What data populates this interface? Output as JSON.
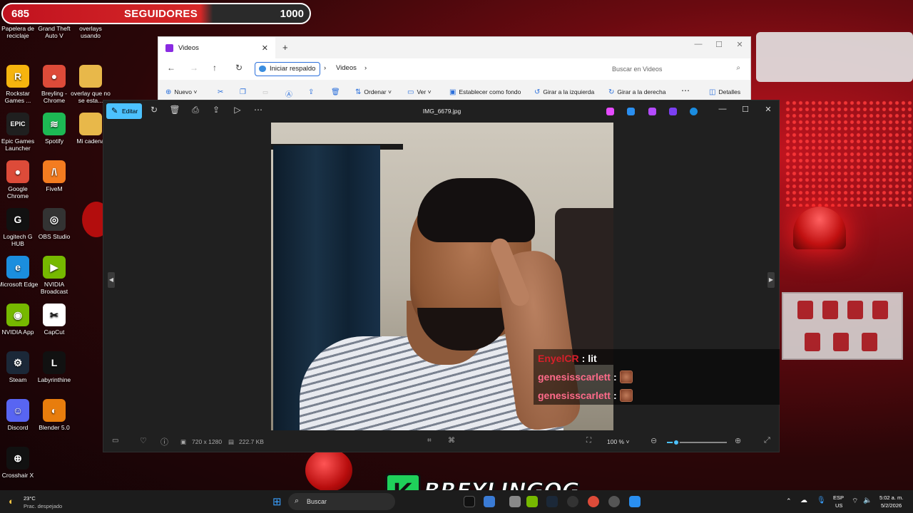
{
  "followers": {
    "current": "685",
    "label": "SEGUIDORES",
    "goal": "1000",
    "progress_fraction": 0.685
  },
  "desktop_icons": [
    {
      "label": "Papelera de reciclaje",
      "color": "#9aa7b3",
      "glyph": "🗑"
    },
    {
      "label": "Grand Theft Auto V",
      "color": "#6b4a2b",
      "glyph": "V"
    },
    {
      "label": "overlays usando",
      "color": "#e8b84a",
      "glyph": ""
    },
    {
      "label": "Rockstar Games ...",
      "color": "#f6b40e",
      "glyph": "R"
    },
    {
      "label": "Breyling - Chrome",
      "color": "#dd4b39",
      "glyph": "●"
    },
    {
      "label": "overlay que no se esta...",
      "color": "#e8b84a",
      "glyph": ""
    },
    {
      "label": "Epic Games Launcher",
      "color": "#1f1f1f",
      "glyph": "EPIC"
    },
    {
      "label": "Spotify",
      "color": "#1db954",
      "glyph": "≋"
    },
    {
      "label": "Mi cadena",
      "color": "#e8b84a",
      "glyph": ""
    },
    {
      "label": "Google Chrome",
      "color": "#dd4b39",
      "glyph": "●"
    },
    {
      "label": "FiveM",
      "color": "#f47c20",
      "glyph": "/\\"
    },
    {
      "label": "Logitech G HUB",
      "color": "#111111",
      "glyph": "G"
    },
    {
      "label": "OBS Studio",
      "color": "#333333",
      "glyph": "◎"
    },
    {
      "label": "Microsoft Edge",
      "color": "#1b8ede",
      "glyph": "e"
    },
    {
      "label": "NVIDIA Broadcast",
      "color": "#76b900",
      "glyph": "▶"
    },
    {
      "label": "NVIDIA App",
      "color": "#76b900",
      "glyph": "◉"
    },
    {
      "label": "CapCut",
      "color": "#ffffff",
      "glyph": "✂"
    },
    {
      "label": "Steam",
      "color": "#1b2838",
      "glyph": "⚙"
    },
    {
      "label": "Labyrinthine",
      "color": "#111111",
      "glyph": "L"
    },
    {
      "label": "Discord",
      "color": "#5865f2",
      "glyph": "☺"
    },
    {
      "label": "Blender 5.0",
      "color": "#e87d0d",
      "glyph": "◐"
    },
    {
      "label": "Crosshair X",
      "color": "#111111",
      "glyph": "⊕"
    }
  ],
  "explorer": {
    "tab_title": "Videos",
    "backup_button": "Iniciar respaldo",
    "breadcrumb": "Videos",
    "search_placeholder": "Buscar en Videos",
    "commands": {
      "new": "Nuevo",
      "sort": "Ordenar",
      "view": "Ver",
      "set_background": "Establecer como fondo",
      "rotate_left": "Girar a la izquierda",
      "rotate_right": "Girar a la derecha",
      "details": "Detalles"
    }
  },
  "photos": {
    "edit_label": "Editar",
    "file_name": "IMG_6679.jpg",
    "dimensions": "720 x 1280",
    "file_size": "222.7 KB",
    "zoom_level": "100 %",
    "zoom_fraction": 0.15
  },
  "chat": [
    {
      "user": "EnyelCR",
      "message": "lit",
      "emote": false
    },
    {
      "user": "genesisscarlett",
      "message": "",
      "emote": true
    },
    {
      "user": "genesisscarlett",
      "message": "",
      "emote": true
    }
  ],
  "brand": {
    "letter": "K",
    "name": "BREYLINGOG",
    "color": "#1fd05a"
  },
  "taskbar": {
    "weather_temp": "23°C",
    "weather_desc": "Prac. despejado",
    "search_label": "Buscar",
    "lang_top": "ESP",
    "lang_bottom": "US",
    "time": "5:02 a. m.",
    "date": "5/2/2026"
  }
}
